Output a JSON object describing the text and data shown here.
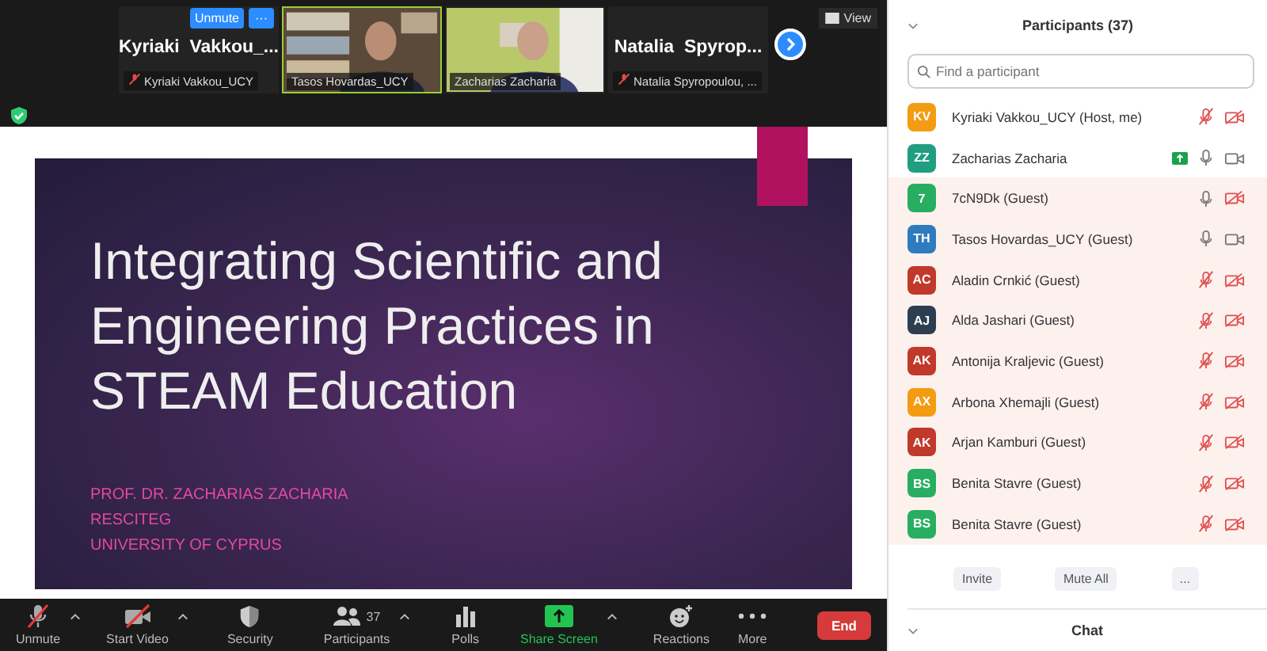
{
  "meeting": {
    "view_label": "View",
    "tiles": [
      {
        "kind": "name",
        "name": "Kyriaki  Vakkou_...",
        "label": "Kyriaki Vakkou_UCY",
        "muted": true,
        "selected": false,
        "unmute_button": "Unmute",
        "more_button": "···"
      },
      {
        "kind": "video",
        "label": "Tasos Hovardas_UCY",
        "selected": true
      },
      {
        "kind": "video",
        "label": "Zacharias Zacharia",
        "selected": false
      },
      {
        "kind": "name",
        "name": "Natalia  Spyrop...",
        "label": "Natalia Spyropoulou, ...",
        "muted": true,
        "selected": false
      }
    ]
  },
  "slide": {
    "title": "Integrating Scientific and Engineering Practices in STEAM Education",
    "lines": [
      "PROF. DR. ZACHARIAS ZACHARIA",
      "RESCITEG",
      "UNIVERSITY OF CYPRUS"
    ]
  },
  "toolbar": {
    "items": [
      {
        "kind": "mic",
        "label": "Unmute",
        "caret": true
      },
      {
        "kind": "video",
        "label": "Start Video",
        "caret": true
      },
      {
        "kind": "security",
        "label": "Security",
        "caret": false
      },
      {
        "kind": "participants",
        "label": "Participants",
        "count": "37",
        "caret": true
      },
      {
        "kind": "polls",
        "label": "Polls",
        "caret": false
      },
      {
        "kind": "share",
        "label": "Share Screen",
        "caret": true
      },
      {
        "kind": "reactions",
        "label": "Reactions",
        "caret": false
      },
      {
        "kind": "more",
        "label": "More",
        "caret": false
      }
    ],
    "end_button": "End"
  },
  "panel": {
    "title": "Participants (37)",
    "search": {
      "placeholder": "Find a participant"
    },
    "participants": [
      {
        "initials": "KV",
        "color": "#f39c12",
        "name": "Kyriaki Vakkou_UCY (Host, me)",
        "muted": true,
        "video": false,
        "sharing": false,
        "highlighted": false
      },
      {
        "initials": "ZZ",
        "color": "#1f9e80",
        "name": "Zacharias Zacharia",
        "muted": false,
        "video": true,
        "sharing": true,
        "highlighted": false
      },
      {
        "initials": "7",
        "color": "#27ae60",
        "name": "7cN9Dk (Guest)",
        "muted": false,
        "video": false,
        "sharing": false,
        "highlighted": true
      },
      {
        "initials": "TH",
        "color": "#2e7bbf",
        "name": "Tasos Hovardas_UCY (Guest)",
        "muted": false,
        "video": true,
        "sharing": false,
        "highlighted": true
      },
      {
        "initials": "AC",
        "color": "#c0392b",
        "name": "Aladin Crnkić (Guest)",
        "muted": true,
        "video": false,
        "sharing": false,
        "highlighted": true
      },
      {
        "initials": "AJ",
        "color": "#2c3e50",
        "name": "Alda Jashari (Guest)",
        "muted": true,
        "video": false,
        "sharing": false,
        "highlighted": true
      },
      {
        "initials": "AK",
        "color": "#c0392b",
        "name": "Antonija Kraljevic (Guest)",
        "muted": true,
        "video": false,
        "sharing": false,
        "highlighted": true
      },
      {
        "initials": "AX",
        "color": "#f39c12",
        "name": "Arbona Xhemajli (Guest)",
        "muted": true,
        "video": false,
        "sharing": false,
        "highlighted": true
      },
      {
        "initials": "AK",
        "color": "#c0392b",
        "name": "Arjan Kamburi (Guest)",
        "muted": true,
        "video": false,
        "sharing": false,
        "highlighted": true
      },
      {
        "initials": "BS",
        "color": "#27ae60",
        "name": "Benita Stavre (Guest)",
        "muted": true,
        "video": false,
        "sharing": false,
        "highlighted": true
      },
      {
        "initials": "BS",
        "color": "#27ae60",
        "name": "Benita Stavre (Guest)",
        "muted": true,
        "video": false,
        "sharing": false,
        "highlighted": true
      }
    ],
    "buttons": [
      "Invite",
      "Mute All",
      "..."
    ],
    "chat": "Chat"
  }
}
